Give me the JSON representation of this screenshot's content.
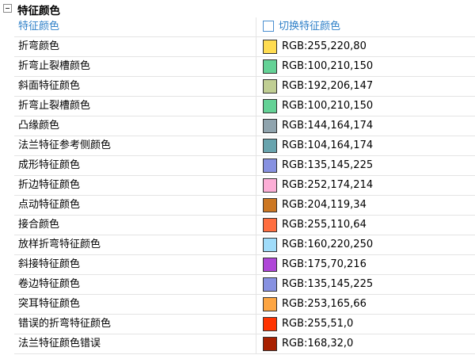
{
  "group": {
    "title": "特征颜色",
    "expanded": true
  },
  "header": {
    "name": "特征颜色",
    "toggle_label": "切换特征颜色",
    "toggle_checked": false
  },
  "rows": [
    {
      "name": "折弯颜色",
      "value": "RGB:255,220,80",
      "color": "#ffdc50"
    },
    {
      "name": "折弯止裂槽颜色",
      "value": "RGB:100,210,150",
      "color": "#64d296"
    },
    {
      "name": "斜面特征颜色",
      "value": "RGB:192,206,147",
      "color": "#c0ce93"
    },
    {
      "name": "折弯止裂槽颜色",
      "value": "RGB:100,210,150",
      "color": "#64d296"
    },
    {
      "name": "凸缘颜色",
      "value": "RGB:144,164,174",
      "color": "#90a4ae"
    },
    {
      "name": "法兰特征参考侧颜色",
      "value": "RGB:104,164,174",
      "color": "#68a4ae"
    },
    {
      "name": "成形特征颜色",
      "value": "RGB:135,145,225",
      "color": "#8791e1"
    },
    {
      "name": "折边特征颜色",
      "value": "RGB:252,174,214",
      "color": "#fcaed6"
    },
    {
      "name": "点动特征颜色",
      "value": "RGB:204,119,34",
      "color": "#cc7722"
    },
    {
      "name": "接合颜色",
      "value": "RGB:255,110,64",
      "color": "#ff6e40"
    },
    {
      "name": "放样折弯特征颜色",
      "value": "RGB:160,220,250",
      "color": "#a0dcfa"
    },
    {
      "name": "斜接特征颜色",
      "value": "RGB:175,70,216",
      "color": "#af46d8"
    },
    {
      "name": "卷边特征颜色",
      "value": "RGB:135,145,225",
      "color": "#8791e1"
    },
    {
      "name": "突耳特征颜色",
      "value": "RGB:253,165,66",
      "color": "#fda542"
    },
    {
      "name": "错误的折弯特征颜色",
      "value": "RGB:255,51,0",
      "color": "#ff3300"
    },
    {
      "name": "法兰特征颜色错误",
      "value": "RGB:168,32,0",
      "color": "#a82000"
    }
  ]
}
